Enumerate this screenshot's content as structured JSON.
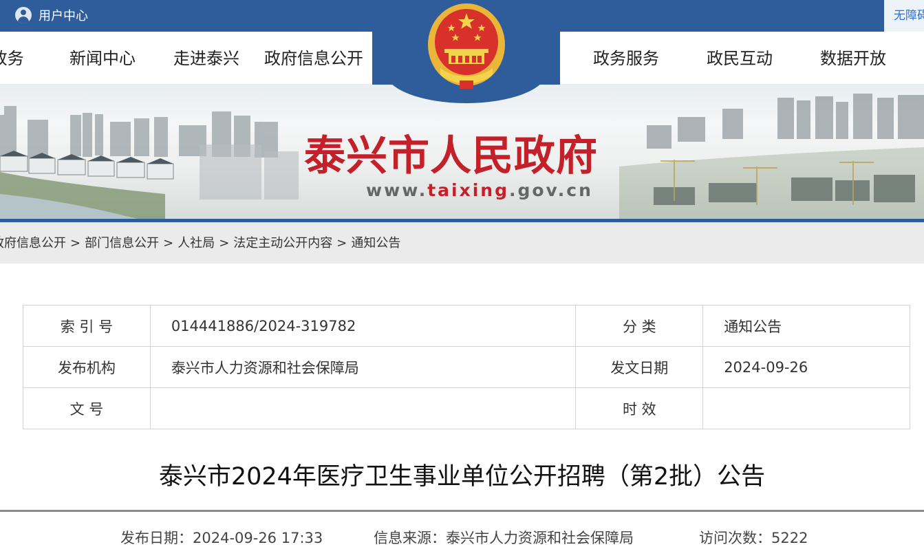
{
  "topbar": {
    "user_center_label": "用户中心",
    "accessibility_label": "无障碍"
  },
  "nav": {
    "items": [
      "市政务",
      "新闻中心",
      "走进泰兴",
      "政府信息公开",
      "政务服务",
      "政民互动",
      "数据开放"
    ],
    "first_visible": "-政务"
  },
  "banner": {
    "title": "泰兴市人民政府",
    "url_prefix": "www.",
    "url_highlight": "taixing",
    "url_suffix": ".gov.cn"
  },
  "breadcrumb": [
    "政府信息公开",
    "部门信息公开",
    "人社局",
    "法定主动公开内容",
    "通知公告"
  ],
  "breadcrumb_separator": ">",
  "info": {
    "index_label": "索 引 号",
    "index_value": "014441886/2024-319782",
    "category_label": "分 类",
    "category_value": "通知公告",
    "publisher_label": "发布机构",
    "publisher_value": "泰兴市人力资源和社会保障局",
    "issue_date_label": "发文日期",
    "issue_date_value": "2024-09-26",
    "doc_no_label": "文 号",
    "doc_no_value": "",
    "validity_label": "时 效",
    "validity_value": ""
  },
  "article": {
    "title": "泰兴市2024年医疗卫生事业单位公开招聘（第2批）公告",
    "publish_date": "发布日期：2024-09-26 17:33",
    "source": "信息来源：泰兴市人力资源和社会保障局",
    "visits": "访问次数：5222"
  },
  "colors": {
    "brand_blue": "#2f5d9c",
    "title_red": "#c4202a",
    "breadcrumb_bg": "#ebebeb"
  }
}
